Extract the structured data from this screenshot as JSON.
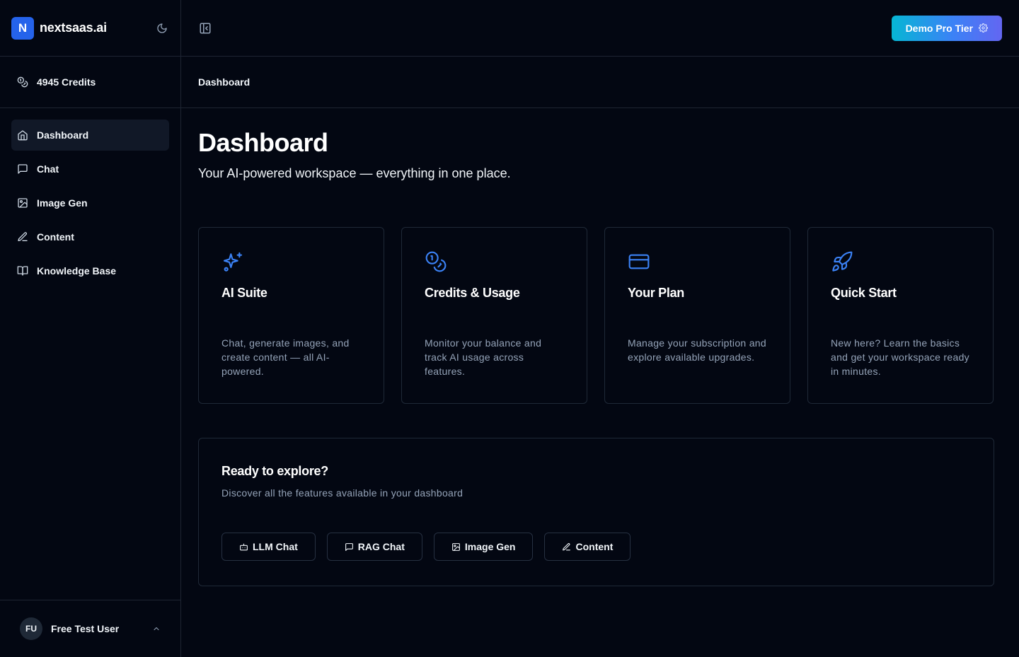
{
  "app": {
    "logo_letter": "N",
    "name": "nextsaas.ai"
  },
  "sidebar": {
    "credits_label": "4945 Credits",
    "items": [
      {
        "label": "Dashboard",
        "icon": "home-icon",
        "active": true
      },
      {
        "label": "Chat",
        "icon": "message-square-icon"
      },
      {
        "label": "Image Gen",
        "icon": "image-icon"
      },
      {
        "label": "Content",
        "icon": "pen-icon"
      },
      {
        "label": "Knowledge Base",
        "icon": "book-open-icon"
      }
    ],
    "user": {
      "initials": "FU",
      "name": "Free Test User"
    }
  },
  "header": {
    "tier_button_label": "Demo Pro Tier",
    "breadcrumb": "Dashboard"
  },
  "main": {
    "title": "Dashboard",
    "subtitle": "Your AI-powered workspace — everything in one place.",
    "cards": [
      {
        "title": "AI Suite",
        "icon": "sparkles-icon",
        "description": "Chat, generate images, and create content — all AI-powered."
      },
      {
        "title": "Credits & Usage",
        "icon": "coins-icon",
        "description": "Monitor your balance and track AI usage across features."
      },
      {
        "title": "Your Plan",
        "icon": "credit-card-icon",
        "description": "Manage your subscription and explore available upgrades."
      },
      {
        "title": "Quick Start",
        "icon": "rocket-icon",
        "description": "New here? Learn the basics and get your workspace ready in minutes."
      }
    ],
    "explore": {
      "title": "Ready to explore?",
      "subtitle": "Discover all the features available in your dashboard",
      "buttons": [
        {
          "label": "LLM Chat",
          "icon": "bot-icon"
        },
        {
          "label": "RAG Chat",
          "icon": "message-square-icon"
        },
        {
          "label": "Image Gen",
          "icon": "image-icon"
        },
        {
          "label": "Content",
          "icon": "pen-icon"
        }
      ]
    }
  },
  "colors": {
    "background": "#030712",
    "accent": "#3b82f6",
    "gradient_start": "#06b6d4",
    "gradient_end": "#6366f1",
    "muted_text": "#94a3b8"
  }
}
